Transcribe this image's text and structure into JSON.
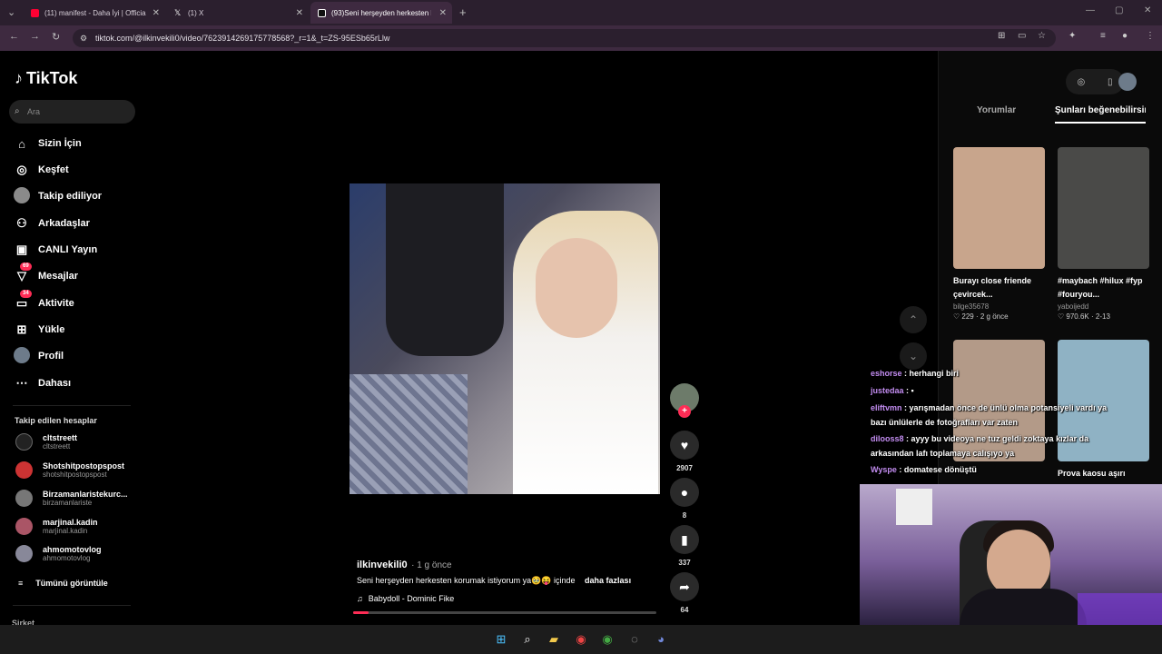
{
  "browser": {
    "tabs": [
      {
        "title": "(11) manifest - Daha İyi | Officia",
        "color": "#ff0033"
      },
      {
        "title": "(1) X",
        "color": "#ffffff"
      },
      {
        "title": "(93)Seni herşeyden herkesten k",
        "color": "#111111"
      }
    ],
    "url": "tiktok.com/@ilkinvekili0/video/7623914269175778568?_r=1&_t=ZS-95ESb65rLlw"
  },
  "sidebar": {
    "logo": "TikTok",
    "search_placeholder": "Ara",
    "nav": [
      {
        "label": "Sizin İçin",
        "icon": "home-icon"
      },
      {
        "label": "Keşfet",
        "icon": "compass-icon"
      },
      {
        "label": "Takip ediliyor",
        "icon": "avatar-icon"
      },
      {
        "label": "Arkadaşlar",
        "icon": "friends-icon"
      },
      {
        "label": "CANLI Yayın",
        "icon": "live-icon"
      },
      {
        "label": "Mesajlar",
        "icon": "message-icon",
        "badge": "69"
      },
      {
        "label": "Aktivite",
        "icon": "activity-icon",
        "badge": "34"
      },
      {
        "label": "Yükle",
        "icon": "upload-icon"
      },
      {
        "label": "Profil",
        "icon": "profile-icon"
      },
      {
        "label": "Dahası",
        "icon": "more-icon"
      }
    ],
    "following_label": "Takip edilen hesaplar",
    "following": [
      {
        "name": "cltstreett",
        "handle": "cltstreett"
      },
      {
        "name": "Shotshitpostopspost",
        "handle": "shotshitpostopspost"
      },
      {
        "name": "Birzamanlaristekurc...",
        "handle": "birzamanlariste"
      },
      {
        "name": "marjinal.kadin",
        "handle": "marjinal.kadin"
      },
      {
        "name": "ahmomotovlog",
        "handle": "ahmomotovlog"
      }
    ],
    "see_all": "Tümünü görüntüle",
    "company": "Şirket"
  },
  "video": {
    "author": "ilkinvekili0",
    "ago": "· 1 g önce",
    "description": "Seni herşeyden herkesten korumak istiyorum ya🥹😝 içinde",
    "more": "daha fazlası",
    "music": "Babydoll - Dominic Fike",
    "progress": 0.05,
    "likes": "2907",
    "comments": "8",
    "saves": "337",
    "shares": "64"
  },
  "right_panel": {
    "tab_comments": "Yorumlar",
    "tab_suggested": "Şunları beğenebilirsin",
    "cards": [
      {
        "title": "Burayı close friende çevircek...",
        "user": "bilge35678",
        "likes": "229",
        "date": "2 g önce",
        "color": "#c8a58c"
      },
      {
        "title": "#maybach #hilux #fyp #fouryou...",
        "user": "yaboijedd",
        "likes": "970.6K",
        "date": "2-13",
        "color": "#4a4a48"
      },
      {
        "title": "",
        "user": "",
        "likes": "",
        "date": "",
        "color": "#b39a88"
      },
      {
        "title": "Prova kaosu aşırı",
        "user": "",
        "likes": "",
        "date": "",
        "color": "#8fb2c4"
      }
    ]
  },
  "chat": [
    {
      "user": "eshorse",
      "msg": "herhangi biri",
      "color": "#c28cf0"
    },
    {
      "user": "justedaa",
      "msg": "",
      "color": "#c28cf0"
    },
    {
      "user": "eliftvmn",
      "msg": "yarışmadan önce de ünlü olma potansiyeli vardı ya",
      "color": "#c28cf0"
    },
    {
      "user": "",
      "msg": "bazı ünlülerle de fotoğrafları var zaten",
      "color": "#c28cf0"
    },
    {
      "user": "dilooss8",
      "msg": "ayyy bu videoya ne tuz geldi zoktaya kızlar da",
      "color": "#c28cf0"
    },
    {
      "user": "",
      "msg": "arkasından lafı toplamaya calışıyo ya",
      "color": "#c28cf0"
    },
    {
      "user": "Wyspe",
      "msg": "domatese dönüştü",
      "color": "#c28cf0"
    }
  ]
}
